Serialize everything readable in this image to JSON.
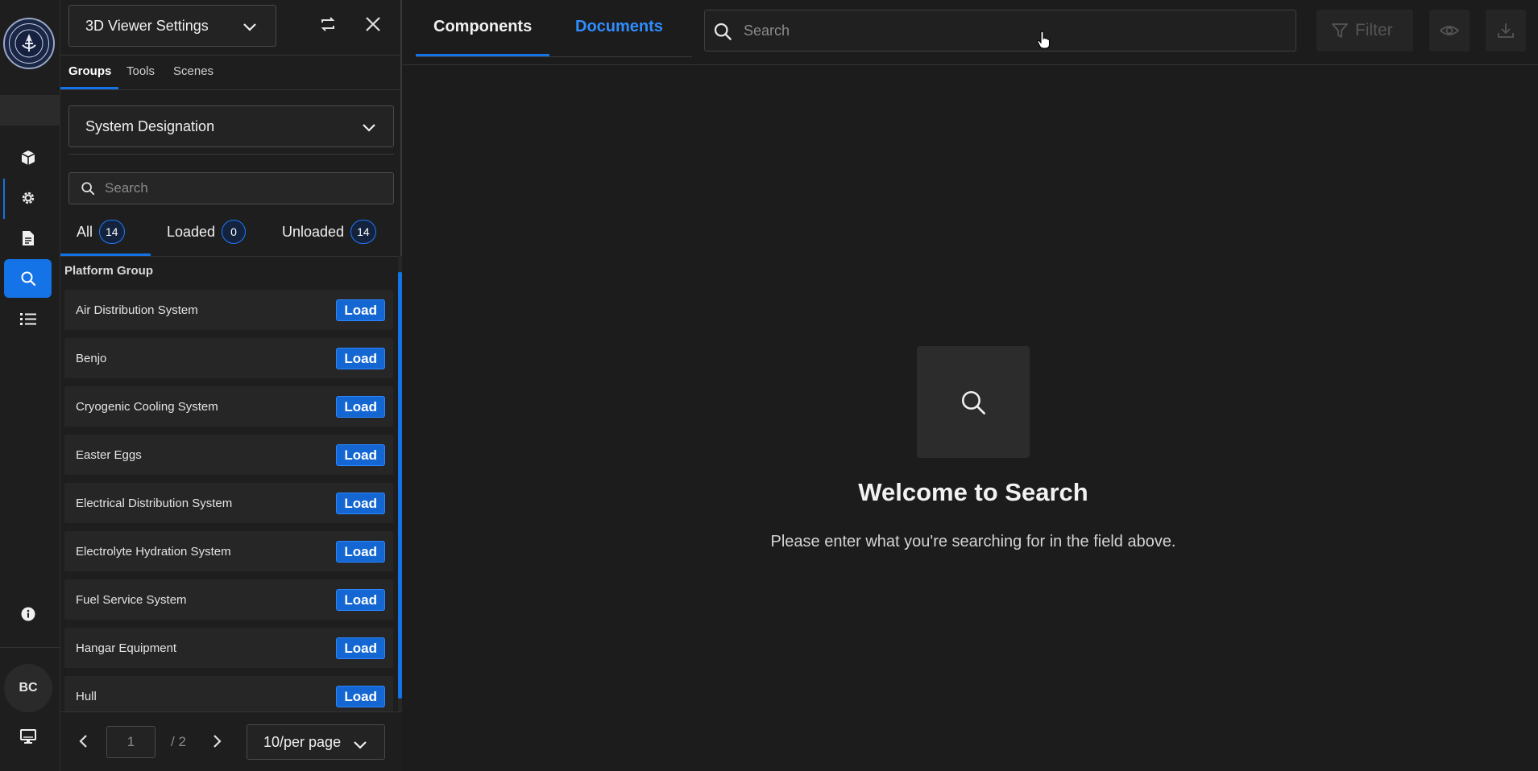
{
  "rail": {
    "logo": "ship-emblem-logo",
    "items": [
      {
        "icon": "cube-icon",
        "active": false
      },
      {
        "icon": "gear-icon",
        "active": false
      },
      {
        "icon": "document-icon",
        "active": false
      },
      {
        "icon": "search-icon",
        "active": true
      },
      {
        "icon": "list-icon",
        "active": false
      }
    ],
    "info_icon": "info-icon",
    "avatar_initials": "BC",
    "monitor_icon": "monitor-icon"
  },
  "panel": {
    "viewer_select": "3D Viewer Settings",
    "sub_tabs": [
      "Groups",
      "Tools",
      "Scenes"
    ],
    "active_sub_tab": "Groups",
    "group_by": "System Designation",
    "search_placeholder": "Search",
    "filters": [
      {
        "label": "All",
        "count": "14"
      },
      {
        "label": "Loaded",
        "count": "0"
      },
      {
        "label": "Unloaded",
        "count": "14"
      }
    ],
    "group_heading": "Platform Group",
    "load_label": "Load",
    "groups": [
      "Air Distribution System",
      "Benjo",
      "Cryogenic Cooling System",
      "Easter Eggs",
      "Electrical Distribution System",
      "Electrolyte Hydration System",
      "Fuel Service System",
      "Hangar Equipment",
      "Hull"
    ],
    "pagination": {
      "current_page": "1",
      "total": "/ 2",
      "per_page": "10/per page"
    }
  },
  "main": {
    "tabs": [
      "Components",
      "Documents"
    ],
    "active_tab": "Components",
    "search_placeholder": "Search",
    "filter_label": "Filter",
    "empty_state": {
      "title": "Welcome to Search",
      "subtitle": "Please enter what you're searching for in the field above."
    }
  },
  "colors": {
    "accent": "#1473e6",
    "background": "#1c1c1c",
    "panel": "#1e1e1e",
    "row": "#262626",
    "link_active": "#2f8dff"
  }
}
